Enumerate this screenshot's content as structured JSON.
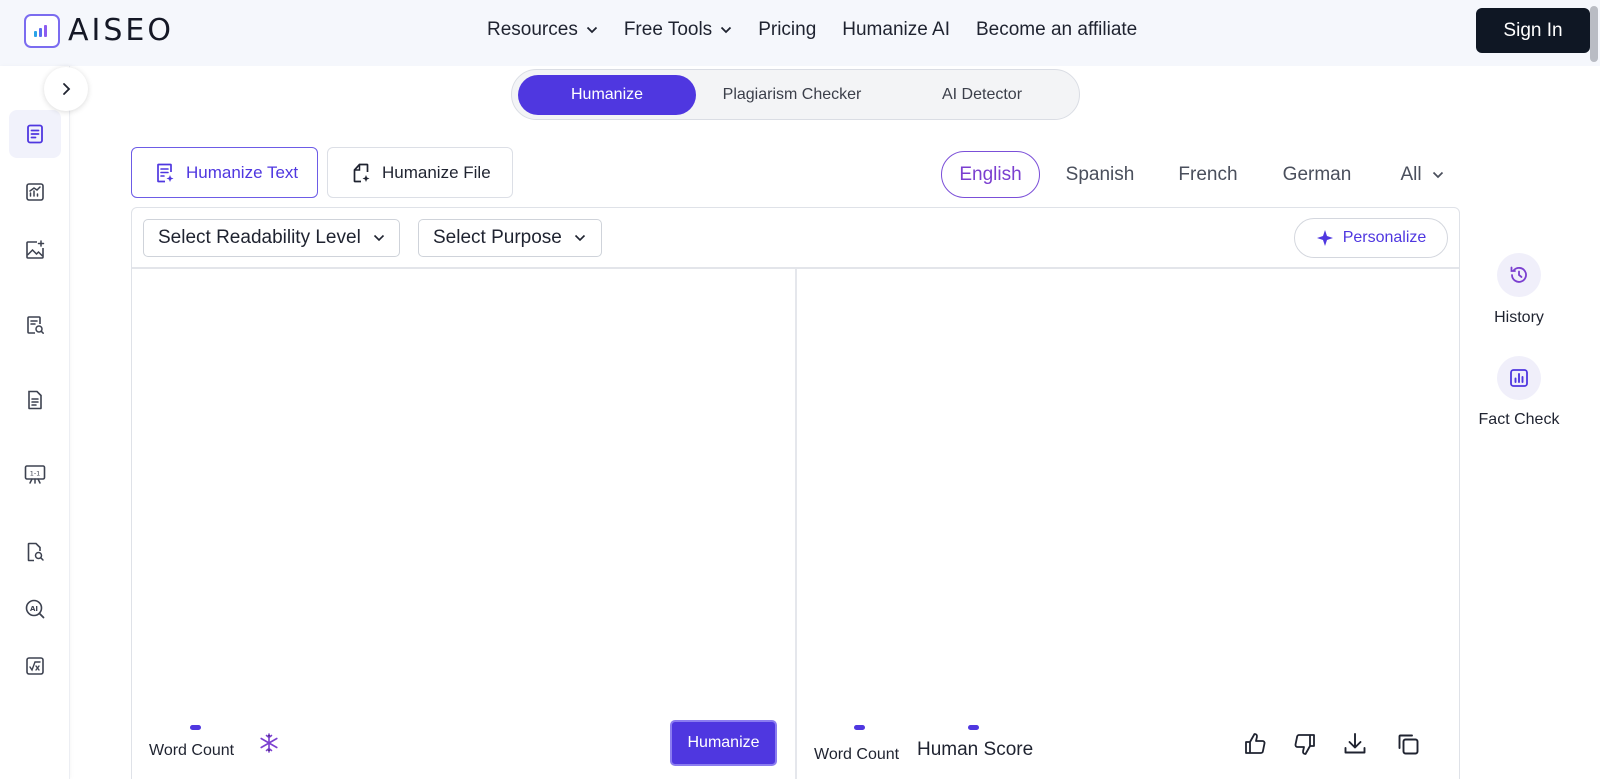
{
  "brand": {
    "name": "AISEO"
  },
  "nav": {
    "items": [
      {
        "label": "Resources",
        "has_dropdown": true
      },
      {
        "label": "Free Tools",
        "has_dropdown": true
      },
      {
        "label": "Pricing",
        "has_dropdown": false
      },
      {
        "label": "Humanize AI",
        "has_dropdown": false
      },
      {
        "label": "Become an affiliate",
        "has_dropdown": false
      }
    ],
    "signin_label": "Sign In"
  },
  "mode_tabs": [
    {
      "label": "Humanize",
      "active": true
    },
    {
      "label": "Plagiarism Checker",
      "active": false
    },
    {
      "label": "AI Detector",
      "active": false
    }
  ],
  "input_types": [
    {
      "label": "Humanize Text",
      "icon": "document-sparkle-icon",
      "active": true
    },
    {
      "label": "Humanize File",
      "icon": "file-sparkle-icon",
      "active": false
    }
  ],
  "languages": [
    {
      "label": "English",
      "active": true
    },
    {
      "label": "Spanish",
      "active": false
    },
    {
      "label": "French",
      "active": false
    },
    {
      "label": "German",
      "active": false
    },
    {
      "label": "All",
      "active": false,
      "has_dropdown": true
    }
  ],
  "toolbar": {
    "readability_label": "Select Readability Level",
    "purpose_label": "Select Purpose",
    "personalize_label": "Personalize"
  },
  "input_panel": {
    "word_count_label": "Word Count",
    "humanize_label": "Humanize"
  },
  "output_panel": {
    "word_count_label": "Word Count",
    "human_score_label": "Human Score"
  },
  "right_rail": {
    "history_label": "History",
    "fact_check_label": "Fact Check"
  },
  "sidebar": {
    "items": [
      {
        "icon": "document-edit-icon",
        "active": true
      },
      {
        "icon": "chart-icon",
        "active": false
      },
      {
        "icon": "image-sparkle-icon",
        "active": false
      },
      {
        "icon": "document-search-icon",
        "active": false
      },
      {
        "icon": "document-text-icon",
        "active": false
      },
      {
        "icon": "presentation-icon",
        "active": false
      },
      {
        "icon": "file-search-icon",
        "active": false
      },
      {
        "icon": "ai-search-icon",
        "active": false
      },
      {
        "icon": "formula-icon",
        "active": false
      }
    ]
  },
  "colors": {
    "accent": "#4f37e0",
    "header_bg": "#f5f7fc",
    "signin_bg": "#0f1724",
    "language_active": "#7b3fd0"
  }
}
